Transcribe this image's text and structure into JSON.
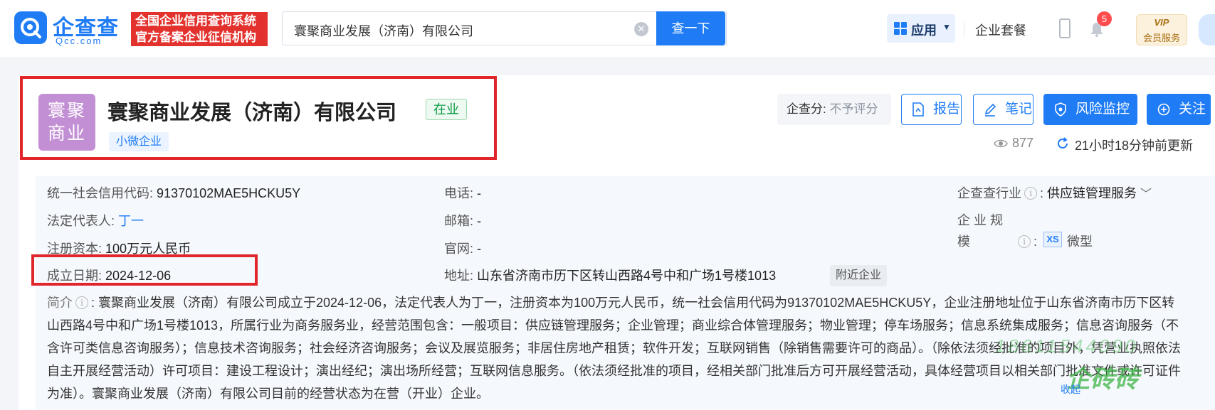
{
  "header": {
    "logo_text": "企查查",
    "logo_sub": "Qcc.com",
    "slogan_line1": "全国企业信用查询系统",
    "slogan_line2": "官方备案企业征信机构",
    "search_value": "寰聚商业发展（济南）有限公司",
    "search_button": "查一下",
    "apps_label": "应用",
    "suite_label": "企业套餐",
    "notification_count": "5",
    "vip_title": "VIP",
    "vip_sub": "会员服务"
  },
  "company": {
    "logo_text": "寰聚商业",
    "name": "寰聚商业发展（济南）有限公司",
    "status": "在业",
    "size_tag": "小微企业",
    "score_label": "企查分:",
    "score_value": "不予评分",
    "actions": {
      "report": "报告",
      "note": "笔记",
      "monitor": "风险监控",
      "follow": "关注"
    },
    "views": "877",
    "updated": "21小时18分钟前更新"
  },
  "info": {
    "credit_code_label": "统一社会信用代码:",
    "credit_code": "91370102MAE5HCKU5Y",
    "legal_rep_label": "法定代表人:",
    "legal_rep": "丁一",
    "capital_label": "注册资本:",
    "capital": "100万元人民币",
    "founded_label": "成立日期:",
    "founded": "2024-12-06",
    "phone_label": "电话:",
    "phone": "-",
    "email_label": "邮箱:",
    "email": "-",
    "website_label": "官网:",
    "website": "-",
    "address_label": "地址:",
    "address": "山东省济南市历下区转山西路4号中和广场1号楼1013",
    "nearby": "附近企业",
    "industry_label": "企查查行业",
    "industry": "供应链管理服务",
    "scale_label_1": "企 业 规",
    "scale_label_2": "模",
    "scale_badge": "XS",
    "scale": "微型"
  },
  "intro": {
    "label": "简介",
    "text": "寰聚商业发展（济南）有限公司成立于2024-12-06，法定代表人为丁一，注册资本为100万元人民币，统一社会信用代码为91370102MAE5HCKU5Y，企业注册地址位于山东省济南市历下区转山西路4号中和广场1号楼1013，所属行业为商务服务业，经营范围包含：一般项目：供应链管理服务；企业管理；商业综合体管理服务；物业管理；停车场服务；信息系统集成服务；信息咨询服务（不含许可类信息咨询服务）；信息技术咨询服务；社会经济咨询服务；会议及展览服务；非居住房地产租赁；软件开发；互联网销售（除销售需要许可的商品）。（除依法须经批准的项目外，凭营业执照依法自主开展经营活动）许可项目：建设工程设计；演出经纪；演出场所经营；互联网信息服务。（依法须经批准的项目，经相关部门批准后方可开展经营活动，具体经营项目以相关部门批准文件或许可证件为准）。寰聚商业发展（济南）有限公司目前的经营状态为在营（开业）企业。",
    "collapse": "收起"
  },
  "watermark": {
    "digits": "18611544090",
    "text": "企砖砖"
  },
  "colors": {
    "brand": "#1f7cf5",
    "highlight_box": "#e0262a",
    "status_green": "#0b9b45"
  }
}
